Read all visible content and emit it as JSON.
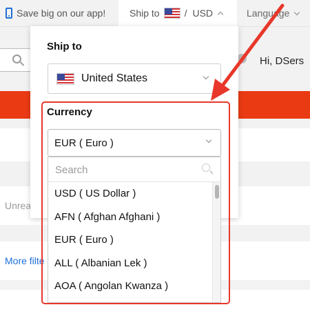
{
  "topbar": {
    "app_promo": "Save big on our app!",
    "ship_to_label": "Ship to",
    "ship_separator": "/",
    "currency_short": "USD",
    "language": "Language"
  },
  "header": {
    "greeting": "Hi, DSers"
  },
  "background": {
    "unread_text": "Unrea",
    "more_filters_text": "More filte"
  },
  "ship_panel": {
    "title": "Ship to",
    "country": "United States",
    "currency_title": "Currency",
    "currency_selected": "EUR ( Euro )",
    "search_placeholder": "Search",
    "currency_options": [
      "USD ( US Dollar )",
      "AFN ( Afghan Afghani )",
      "EUR ( Euro )",
      "ALL ( Albanian Lek )",
      "AOA ( Angolan Kwanza )"
    ]
  },
  "colors": {
    "accent_red": "#ea3a14",
    "annotation_red": "#e8372a",
    "app_icon_blue": "#1e6fd9"
  }
}
